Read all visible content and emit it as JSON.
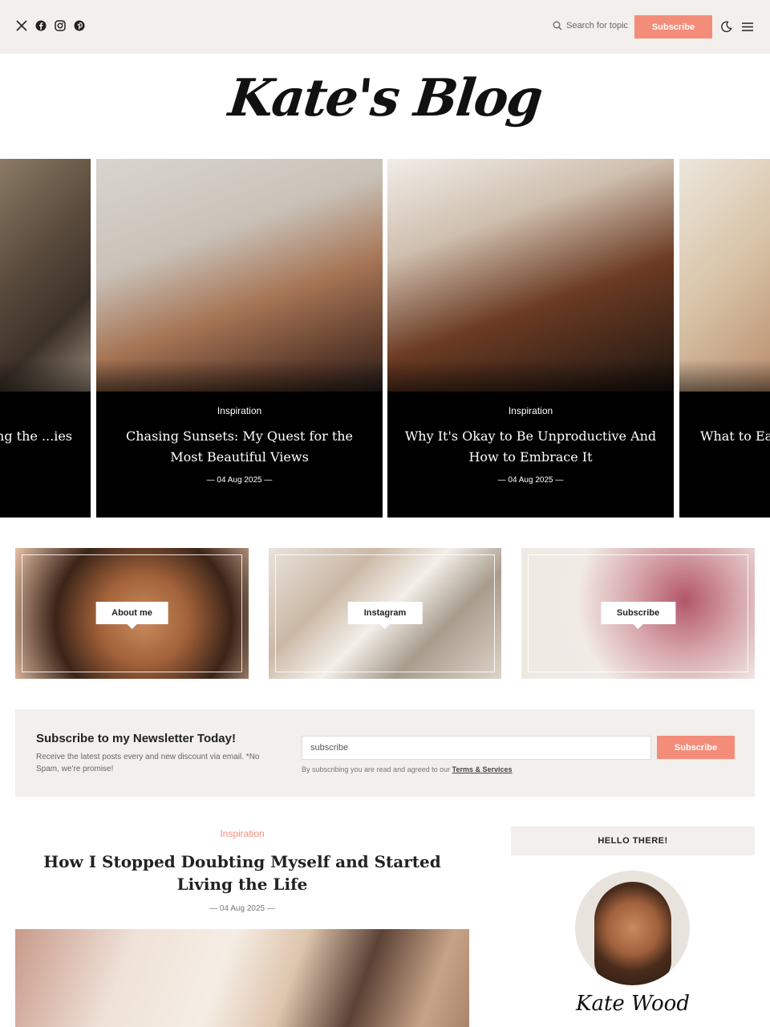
{
  "header": {
    "social_icons": [
      "x-icon",
      "facebook-icon",
      "instagram-icon",
      "pinterest-icon"
    ],
    "search_placeholder": "Search for topic",
    "subscribe_label": "Subscribe"
  },
  "logo": {
    "text": "Kate's Blog"
  },
  "slider": [
    {
      "category": "",
      "title": "...nding the ...ies",
      "date": ""
    },
    {
      "category": "Inspiration",
      "title": "Chasing Sunsets: My Quest for the Most Beautiful Views",
      "date": "— 04 Aug 2025 —"
    },
    {
      "category": "Inspiration",
      "title": "Why It's Okay to Be Unproductive And How to Embrace It",
      "date": "— 04 Aug 2025 —"
    },
    {
      "category": "",
      "title": "What to Ea... Gui...",
      "date": ""
    }
  ],
  "features": [
    {
      "label": "About me"
    },
    {
      "label": "Instagram"
    },
    {
      "label": "Subscribe"
    }
  ],
  "newsletter": {
    "title": "Subscribe to my Newsletter Today!",
    "description": "Receive the latest posts every and new discount via email. *No Spam, we're promise!",
    "input_value": "subscribe",
    "button_label": "Subscribe",
    "terms_prefix": "By subscribing you are read and agreed to our",
    "terms_link": "Terms & Services"
  },
  "post": {
    "category": "Inspiration",
    "title": "How I Stopped Doubting Myself and Started Living the Life",
    "date": "— 04 Aug 2025 —"
  },
  "sidebar": {
    "heading": "HELLO THERE!",
    "signature": "Kate Wood"
  },
  "colors": {
    "accent": "#f48c7a",
    "panel": "#f2efec"
  }
}
